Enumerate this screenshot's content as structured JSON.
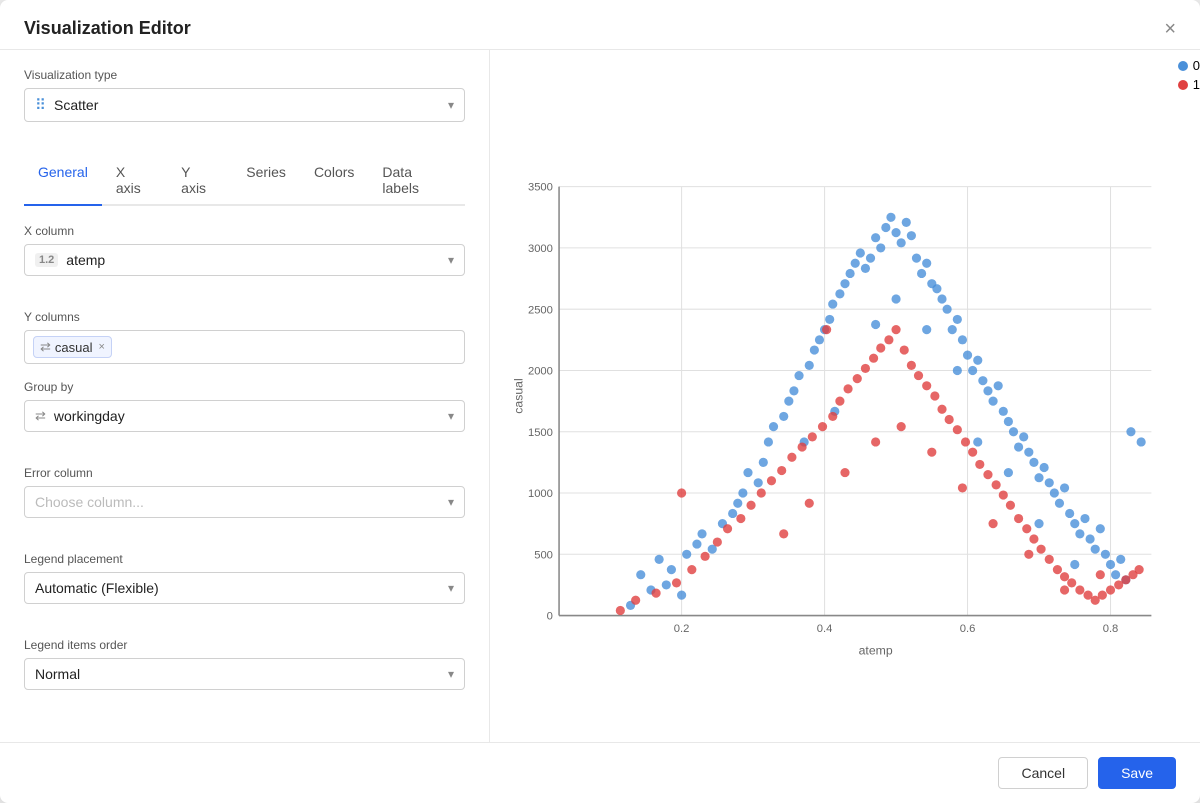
{
  "modal": {
    "title": "Visualization Editor",
    "close_label": "×"
  },
  "left": {
    "viz_type_label": "Visualization type",
    "viz_type_value": "Scatter",
    "viz_type_icon": "⠿",
    "tabs": [
      {
        "id": "general",
        "label": "General",
        "active": true
      },
      {
        "id": "xaxis",
        "label": "X axis",
        "active": false
      },
      {
        "id": "yaxis",
        "label": "Y axis",
        "active": false
      },
      {
        "id": "series",
        "label": "Series",
        "active": false
      },
      {
        "id": "colors",
        "label": "Colors",
        "active": false
      },
      {
        "id": "datalabels",
        "label": "Data labels",
        "active": false
      }
    ],
    "x_column_label": "X column",
    "x_column_value": "atemp",
    "x_column_icon": "1.2",
    "y_columns_label": "Y columns",
    "y_column_tag": "casual",
    "y_column_icon": "⇄",
    "group_by_label": "Group by",
    "group_by_value": "workingday",
    "group_by_icon": "⇄",
    "error_column_label": "Error column",
    "error_column_placeholder": "Choose column...",
    "legend_placement_label": "Legend placement",
    "legend_placement_value": "Automatic (Flexible)",
    "legend_order_label": "Legend items order",
    "legend_order_value": "Normal"
  },
  "footer": {
    "cancel_label": "Cancel",
    "save_label": "Save"
  },
  "chart": {
    "x_axis_label": "atemp",
    "y_axis_label": "casual",
    "x_ticks": [
      "0.2",
      "0.4",
      "0.6",
      "0.8"
    ],
    "y_ticks": [
      "0",
      "500",
      "1000",
      "1500",
      "2000",
      "2500",
      "3000",
      "3500"
    ],
    "legend": [
      {
        "label": "0",
        "color": "#4a90d9"
      },
      {
        "label": "1",
        "color": "#e04040"
      }
    ]
  }
}
